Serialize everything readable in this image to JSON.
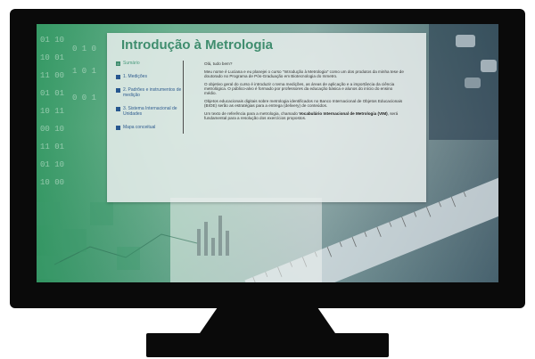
{
  "course": {
    "title": "Introdução à Metrologia"
  },
  "sidebar": {
    "items": [
      {
        "label": "Sumário",
        "icon": "home-icon"
      },
      {
        "label": "1. Medições",
        "icon": "book-icon"
      },
      {
        "label": "2. Padrões e instrumentos de medição",
        "icon": "book-icon"
      },
      {
        "label": "3. Sistema Internacional de Unidades",
        "icon": "book-icon"
      },
      {
        "label": "Mapa conceitual",
        "icon": "bookmark-icon"
      }
    ]
  },
  "content": {
    "greeting": "Olá, tudo bem?",
    "p1": "Meu nome é Luciana e eu planejei o curso \"Introdução à Metrologia\" como um dos produtos da minha tese de doutorado no Programa de Pós-Graduação em Biotecnologia do Inmetro.",
    "p2": "O objetivo geral do curso é introduzir o tema medições, as áreas de aplicação e a importância da ciência metrológica. O público-alvo é formado por professores da educação básica e alunos do início do ensino médio.",
    "p3": "Objetos educacionais digitais sobre metrologia identificados no Banco Internacional de Objetos Educacionais (BIOE) serão as estratégias para a entrega (delivery) de conteúdos.",
    "p4_pre": "Um texto de referência para a metrologia, chamado ",
    "p4_bold": "Vocabulário Internacional de Metrologia (VIM)",
    "p4_post": ", será fundamental para a resolução dos exercícios propostos."
  },
  "colors": {
    "title": "#3f8d6e",
    "nav_link": "#2f5c8f",
    "bezel": "#0a0a0a"
  }
}
